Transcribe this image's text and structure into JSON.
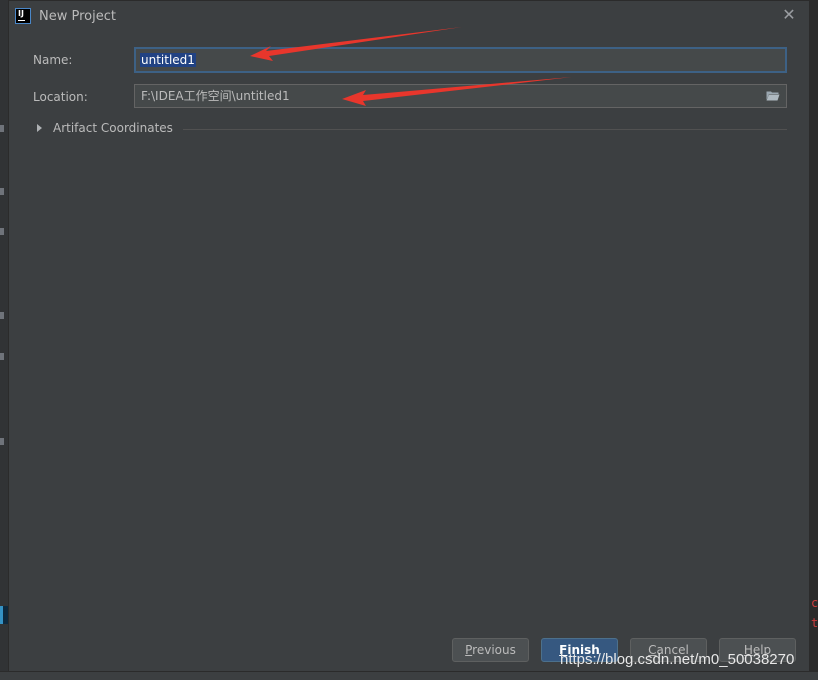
{
  "dialog": {
    "title": "New Project",
    "close_glyph": "✕"
  },
  "form": {
    "name_label": "Name:",
    "name_value": "untitled1",
    "location_label": "Location:",
    "location_value": "F:\\IDEA工作空间\\untitled1",
    "artifact_label": "Artifact Coordinates"
  },
  "buttons": {
    "previous": {
      "mnemonic": "P",
      "rest": "revious"
    },
    "finish": {
      "mnemonic": "F",
      "rest": "inish"
    },
    "cancel": {
      "mnemonic": "C",
      "rest": "ancel"
    },
    "help": {
      "mnemonic": "H",
      "rest": "elp"
    }
  },
  "background": {
    "code_line_1": "c",
    "code_line_2": "t"
  },
  "watermark": "https://blog.csdn.net/m0_50038270",
  "colors": {
    "annotation_arrow": "#e8362c",
    "primary_button": "#365880",
    "dialog_bg": "#3c3f41"
  },
  "icons": {
    "app": "intellij-idea-icon",
    "close": "close-icon",
    "folder": "folder-open-icon",
    "expand": "triangle-right-icon"
  }
}
